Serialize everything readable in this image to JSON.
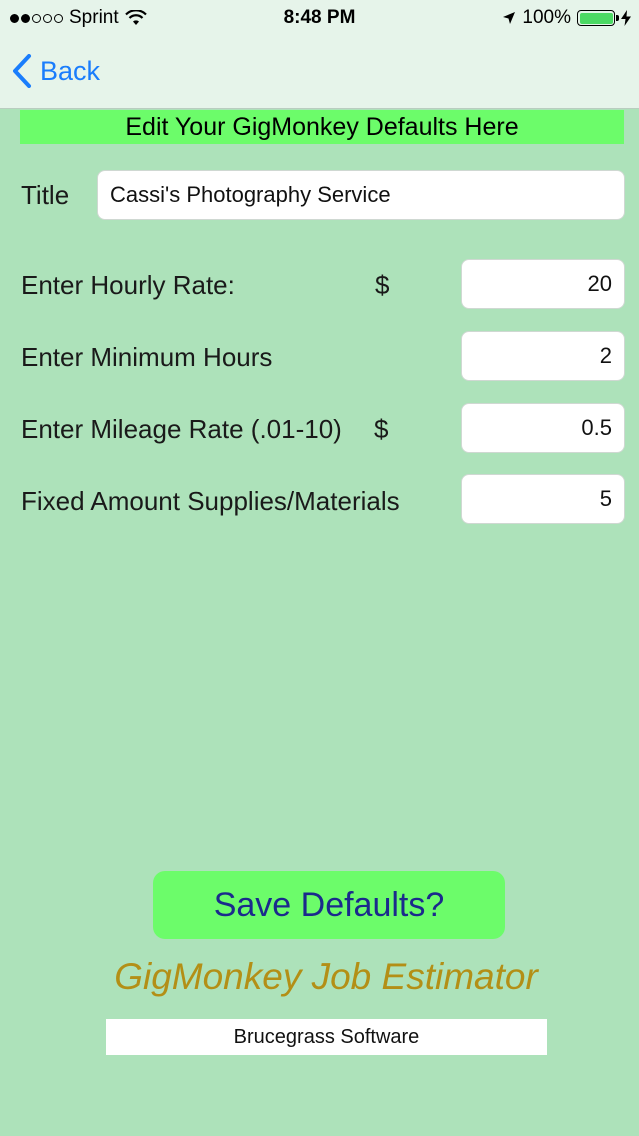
{
  "status_bar": {
    "carrier": "Sprint",
    "time": "8:48 PM",
    "battery_percent": "100%",
    "signal_bars_filled": 2,
    "signal_bars_total": 5
  },
  "nav": {
    "back_label": "Back"
  },
  "banner": {
    "text": "Edit Your GigMonkey Defaults Here"
  },
  "form": {
    "title_label": "Title",
    "title_value": "Cassi's Photography Service",
    "hourly_label": "Enter Hourly Rate:",
    "hourly_currency": "$",
    "hourly_value": "20",
    "min_hours_label": "Enter Minimum Hours",
    "min_hours_value": "2",
    "mileage_label": "Enter Mileage Rate (.01-10)",
    "mileage_currency": "$",
    "mileage_value": "0.5",
    "supplies_label": "Fixed Amount Supplies/Materials",
    "supplies_value": "5"
  },
  "footer": {
    "save_label": "Save Defaults?",
    "app_name": "GigMonkey Job Estimator",
    "company": "Brucegrass Software"
  },
  "colors": {
    "background": "#ade2ba",
    "accent_green": "#6cfc6a",
    "link_blue": "#1a7dfc",
    "app_name_gold": "#b38f16",
    "button_text_navy": "#1b2a8c"
  }
}
